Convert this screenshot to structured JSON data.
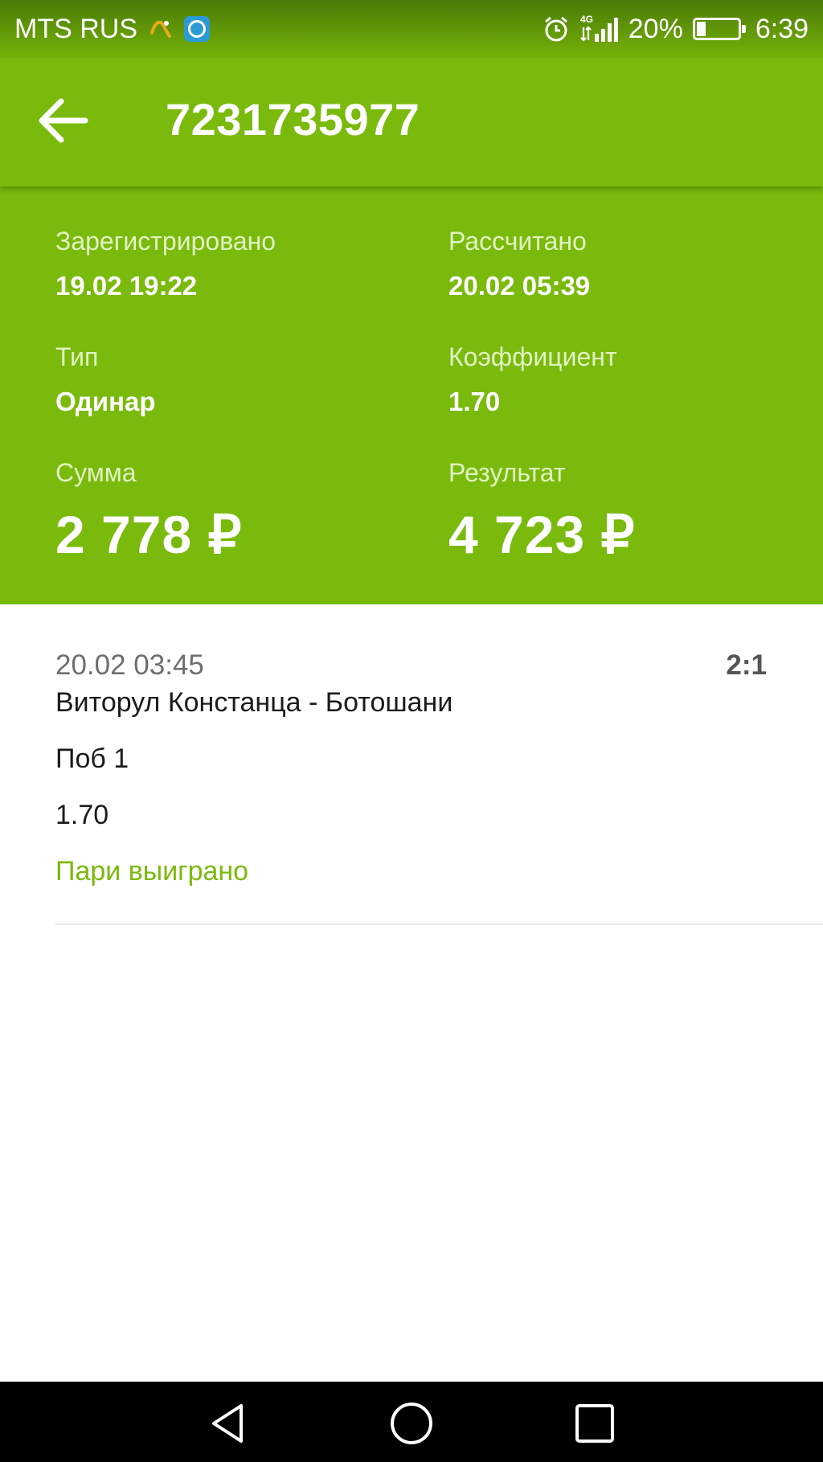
{
  "status_bar": {
    "carrier": "MTS RUS",
    "network": "4G",
    "battery_percent": "20%",
    "battery_level": 0.2,
    "time": "6:39"
  },
  "toolbar": {
    "title": "7231735977",
    "back_icon": "arrow-left-icon"
  },
  "summary": {
    "registered": {
      "label": "Зарегистрировано",
      "value": "19.02 19:22"
    },
    "calculated": {
      "label": "Рассчитано",
      "value": "20.02 05:39"
    },
    "type": {
      "label": "Тип",
      "value": "Одинар"
    },
    "coefficient": {
      "label": "Коэффициент",
      "value": "1.70"
    },
    "amount": {
      "label": "Сумма",
      "value": "2 778 ₽"
    },
    "result": {
      "label": "Результат",
      "value": "4 723 ₽"
    }
  },
  "bet": {
    "date": "20.02 03:45",
    "score": "2:1",
    "event": "Виторул Констанца - Ботошани",
    "outcome": "Поб 1",
    "odds": "1.70",
    "status": "Пари выиграно"
  },
  "colors": {
    "brand_green": "#7aba0c",
    "status_text_green": "#7aba0c"
  }
}
